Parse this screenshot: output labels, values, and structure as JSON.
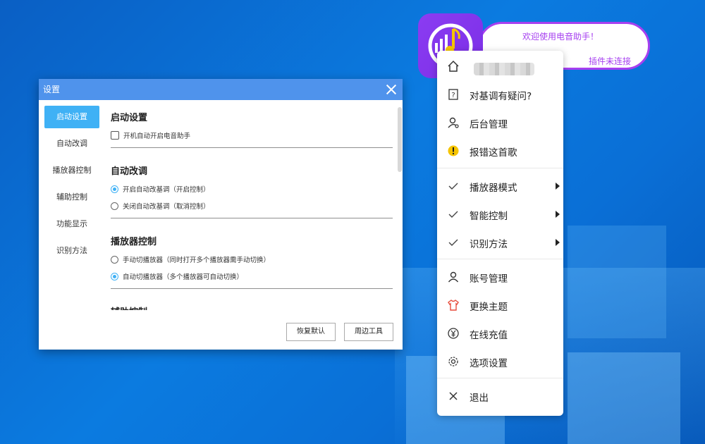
{
  "dialog": {
    "title": "设置",
    "nav": [
      "启动设置",
      "自动改调",
      "播放器控制",
      "辅助控制",
      "功能显示",
      "识别方法"
    ],
    "sections": {
      "startup": {
        "title": "启动设置",
        "option": "开机自动开启电音助手"
      },
      "auto_key": {
        "title": "自动改调",
        "option_on": "开启自动改基调（开启控制）",
        "option_off": "关闭自动改基调（取消控制）"
      },
      "player": {
        "title": "播放器控制",
        "option_manual": "手动切播放器（同时打开多个播放器需手动切换）",
        "option_auto": "自动切播放器（多个播放器可自动切换）"
      },
      "assist": {
        "title": "辅助控制"
      }
    },
    "buttons": {
      "restore": "恢复默认",
      "tools": "周边工具"
    }
  },
  "balloon": {
    "welcome": "欢迎使用电音助手！",
    "status": "插件未连接"
  },
  "menu": {
    "question": "对基调有疑问?",
    "admin": "后台管理",
    "report": "报错这首歌",
    "player_mode": "播放器模式",
    "smart_control": "智能控制",
    "recognition": "识别方法",
    "account": "账号管理",
    "theme": "更换主题",
    "recharge": "在线充值",
    "options": "选项设置",
    "exit": "退出"
  },
  "colors": {
    "accent": "#3fb1f5",
    "brand": "#a63ff0",
    "titlebar": "#4f93ec",
    "warning": "#f5c400",
    "theme_icon": "#e74c3c"
  }
}
